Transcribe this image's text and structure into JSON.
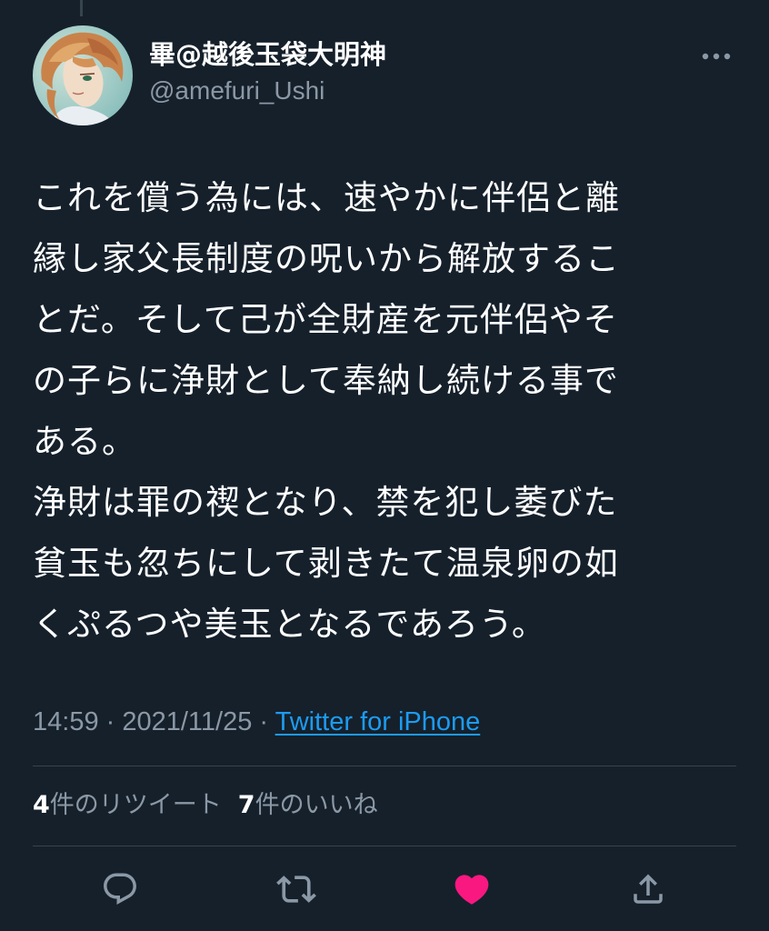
{
  "author": {
    "display_name": "畢@越後玉袋大明神",
    "handle": "@amefuri_Ushi"
  },
  "tweet": {
    "lines": [
      "これを償う為には、速やかに伴侶と離",
      "縁し家父長制度の呪いから解放するこ",
      "とだ。そして己が全財産を元伴侶やそ",
      "の子らに浄財として奉納し続ける事で",
      "ある。",
      "浄財は罪の禊となり、禁を犯し萎びた",
      "貧玉も忽ちにして剥きたて温泉卵の如",
      "くぷるつや美玉となるであろう。"
    ]
  },
  "meta": {
    "time": "14:59",
    "separator": " · ",
    "date": "2021/11/25",
    "source": "Twitter for iPhone"
  },
  "stats": {
    "retweets_count": "4",
    "retweets_label": "件のリツイート",
    "likes_count": "7",
    "likes_label": "件のいいね"
  },
  "icons": {
    "more": "more-horizontal-icon",
    "reply": "reply-icon",
    "retweet": "retweet-icon",
    "like": "heart-icon",
    "share": "share-icon"
  },
  "colors": {
    "background": "#15202b",
    "secondary_text": "#8b98a5",
    "link": "#1d9bf0",
    "like_active": "#f91880",
    "divider": "#38444d"
  }
}
